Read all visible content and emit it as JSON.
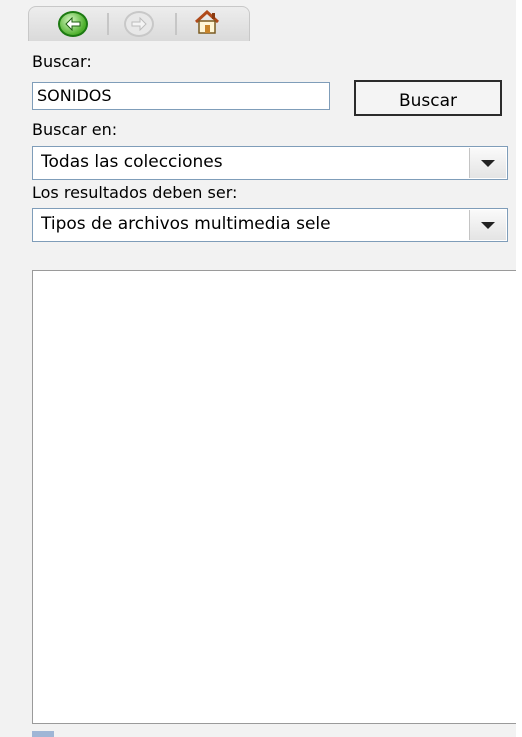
{
  "toolbar": {
    "back_icon": "back-arrow-icon",
    "forward_icon": "forward-arrow-icon",
    "home_icon": "home-icon"
  },
  "search": {
    "label": "Buscar:",
    "value": "SONIDOS",
    "button_label": "Buscar"
  },
  "search_in": {
    "label": "Buscar en:",
    "selected": "Todas las colecciones"
  },
  "results_type": {
    "label": "Los resultados deben ser:",
    "selected": "Tipos de archivos multimedia sele"
  },
  "results": {
    "items": []
  }
}
